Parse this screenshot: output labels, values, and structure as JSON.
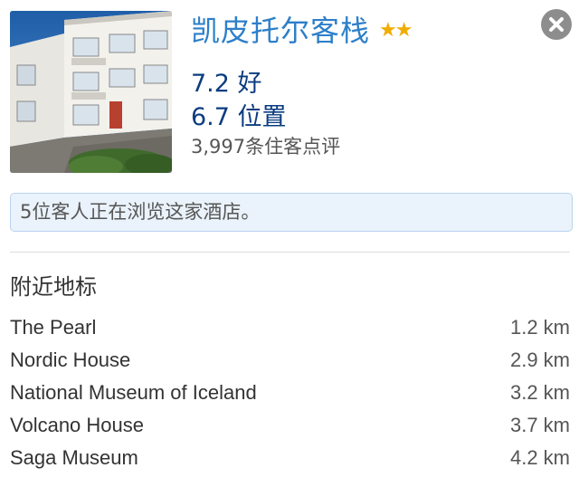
{
  "hotel": {
    "name": "凯皮托尔客栈",
    "stars_text": "★★",
    "star_rating": 2,
    "score_line": "7.2 好",
    "location_line": "6.7 位置",
    "reviews_line": "3,997条住客点评",
    "image_icon": "hotel-photo"
  },
  "close": {
    "icon": "close-icon"
  },
  "viewers_notice": "5位客人正在浏览这家酒店。",
  "nearby": {
    "title": "附近地标",
    "landmarks": [
      {
        "name": "The Pearl",
        "distance": "1.2 km"
      },
      {
        "name": "Nordic House",
        "distance": "2.9 km"
      },
      {
        "name": "National Museum of Iceland",
        "distance": "3.2 km"
      },
      {
        "name": "Volcano House",
        "distance": "3.7 km"
      },
      {
        "name": "Saga Museum",
        "distance": "4.2 km"
      }
    ]
  },
  "colors": {
    "title_blue": "#2d7fc9",
    "score_navy": "#0b3c80",
    "star_gold": "#f0ac00",
    "notice_bg": "#eaf2fb",
    "notice_border": "#b9d3ee",
    "close_gray": "#8d8d8d"
  }
}
